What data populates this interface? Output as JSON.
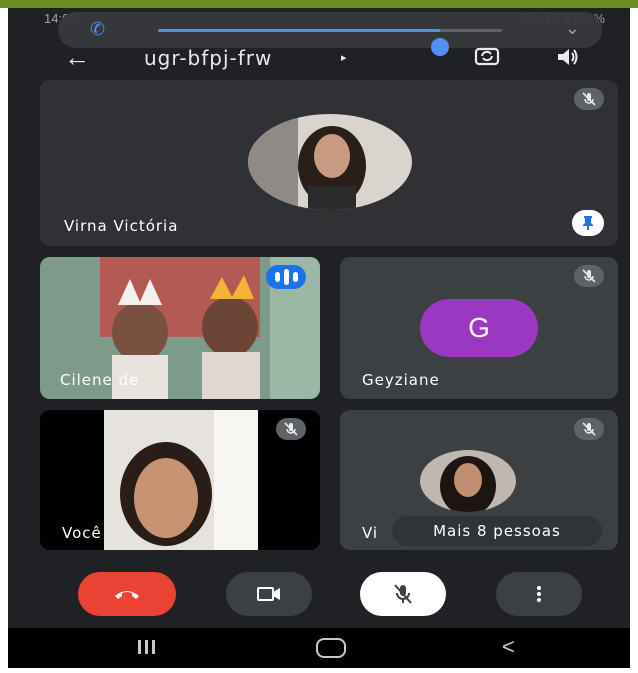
{
  "status_bar": {
    "time": "14:00",
    "right_text": "Vo LTE 91%"
  },
  "volume_overlay": {
    "level": 0.82
  },
  "header": {
    "meeting_code": "ugr-bfpj-frw",
    "caret": "▸"
  },
  "tiles": {
    "main": {
      "name": "Virna Victória"
    },
    "cilene": {
      "name": "Cilene de"
    },
    "geyziane": {
      "name": "Geyziane",
      "initial": "G",
      "avatar_color": "#9b38c2"
    },
    "voce": {
      "name": "Você"
    },
    "vi": {
      "name": "Vi"
    }
  },
  "more_people": "Mais 8 pessoas",
  "colors": {
    "end_call": "#ea4335",
    "accent": "#1a73e8",
    "background": "#202124"
  },
  "icons": [
    "back-arrow-icon",
    "camera-switch-icon",
    "speaker-icon",
    "mic-off-icon",
    "pin-icon",
    "speaking-icon",
    "hangup-icon",
    "video-camera-icon",
    "more-vert-icon"
  ]
}
